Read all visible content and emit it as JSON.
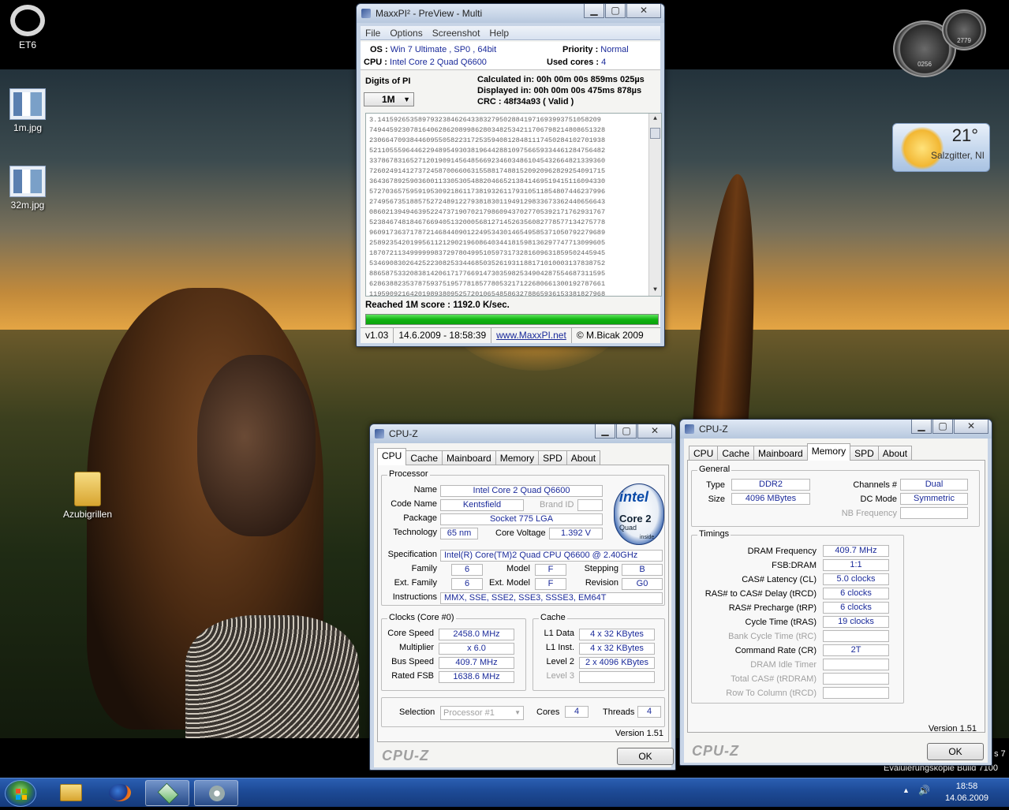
{
  "desktop": {
    "icons": [
      {
        "label": "ET6"
      },
      {
        "label": "1m.jpg"
      },
      {
        "label": "32m.jpg"
      },
      {
        "label": "Azubigrillen"
      }
    ],
    "gadgets": {
      "meter_cpu_value": "0256",
      "meter_ram_value": "2779",
      "weather_temp": "21°",
      "weather_city": "Salzgitter, NI"
    },
    "watermark": {
      "line1": "s 7",
      "line2": "Evaluierungskopie Build 7100"
    }
  },
  "maxxpi": {
    "title": "MaxxPI² - PreView - Multi",
    "menu": [
      "File",
      "Options",
      "Screenshot",
      "Help"
    ],
    "os_label": "OS :",
    "os_value": "Win 7 Ultimate , SP0 , 64bit",
    "cpu_label": "CPU :",
    "cpu_value": "Intel Core 2 Quad Q6600",
    "priority_label": "Priority :",
    "priority_value": "Normal",
    "cores_label": "Used cores :",
    "cores_value": "4",
    "digits_label": "Digits of PI",
    "digits_selected": "1M",
    "calculated": "Calculated in: 00h 00m 00s 859ms 025µs",
    "displayed": "Displayed  in: 00h 00m 00s 475ms 878µs",
    "crc": "CRC : 48f34a93 ( Valid )",
    "pi_lines": [
      "3.1415926535897932384626433832795028841971693993751058209",
      "7494459230781640628620899862803482534211706798214808651328",
      "2306647093844609550582231725359408128481117450284102701938",
      "5211055596446229489549303819644288109756659334461284756482",
      "3378678316527120190914564856692346034861045432664821339360",
      "7260249141273724587006606315588174881520920962829254091715",
      "3643678925903600113305305488204665213841469519415116094330",
      "5727036575959195309218611738193261179310511854807446237996",
      "2749567351885752724891227938183011949129833673362440656643",
      "0860213949463952247371907021798609437027705392171762931767",
      "5238467481846766940513200056812714526356082778577134275778",
      "9609173637178721468440901224953430146549585371050792279689",
      "2589235420199561121290219608640344181598136297747713099605",
      "1870721134999999837297804995105973173281609631859502445945",
      "5346908302642522308253344685035261931188171010003137838752",
      "8865875332083814206171776691473035982534904287554687311595",
      "6286388235378759375195778185778053217122680661300192787661",
      "1195909216420198938095257201065485863278865936153381827968",
      "2303019520353018529689957736225994138912497217752834791315"
    ],
    "score": "Reached 1M score : 1192.0 K/sec.",
    "status": [
      "v1.03",
      "14.6.2009 - 18:58:39",
      "www.MaxxPI.net",
      "© M.Bicak 2009"
    ]
  },
  "cpuz1": {
    "title": "CPU-Z",
    "tabs": [
      "CPU",
      "Cache",
      "Mainboard",
      "Memory",
      "SPD",
      "About"
    ],
    "active_tab": "CPU",
    "processor_group": "Processor",
    "name_label": "Name",
    "name": "Intel Core 2 Quad Q6600",
    "codename_label": "Code Name",
    "codename": "Kentsfield",
    "brandid_label": "Brand ID",
    "package_label": "Package",
    "package": "Socket 775 LGA",
    "technology_label": "Technology",
    "technology": "65 nm",
    "voltage_label": "Core Voltage",
    "voltage": "1.392 V",
    "spec_label": "Specification",
    "spec": "Intel(R) Core(TM)2 Quad CPU     Q6600  @ 2.40GHz",
    "family_label": "Family",
    "family": "6",
    "model_label": "Model",
    "model": "F",
    "stepping_label": "Stepping",
    "stepping": "B",
    "extfamily_label": "Ext. Family",
    "extfamily": "6",
    "extmodel_label": "Ext. Model",
    "extmodel": "F",
    "revision_label": "Revision",
    "revision": "G0",
    "instructions_label": "Instructions",
    "instructions": "MMX, SSE, SSE2, SSE3, SSSE3, EM64T",
    "intel_logo": {
      "brand": "intel",
      "product": "Core 2",
      "sub": "Quad",
      "inside": "inside"
    },
    "clocks_group": "Clocks (Core #0)",
    "corespeed_label": "Core Speed",
    "corespeed": "2458.0 MHz",
    "multiplier_label": "Multiplier",
    "multiplier": "x 6.0",
    "busspeed_label": "Bus Speed",
    "busspeed": "409.7 MHz",
    "ratedfsb_label": "Rated FSB",
    "ratedfsb": "1638.6 MHz",
    "cache_group": "Cache",
    "l1data_label": "L1 Data",
    "l1data": "4 x 32 KBytes",
    "l1inst_label": "L1 Inst.",
    "l1inst": "4 x 32 KBytes",
    "level2_label": "Level 2",
    "level2": "2 x 4096 KBytes",
    "level3_label": "Level 3",
    "selection_label": "Selection",
    "selection": "Processor #1",
    "cores_label": "Cores",
    "cores": "4",
    "threads_label": "Threads",
    "threads": "4",
    "version": "Version 1.51",
    "logo": "CPU-Z",
    "ok": "OK"
  },
  "cpuz2": {
    "title": "CPU-Z",
    "tabs": [
      "CPU",
      "Cache",
      "Mainboard",
      "Memory",
      "SPD",
      "About"
    ],
    "active_tab": "Memory",
    "general_group": "General",
    "type_label": "Type",
    "type": "DDR2",
    "size_label": "Size",
    "size": "4096 MBytes",
    "channels_label": "Channels #",
    "channels": "Dual",
    "dcmode_label": "DC Mode",
    "dcmode": "Symmetric",
    "nbfreq_label": "NB Frequency",
    "timings_group": "Timings",
    "dram_label": "DRAM Frequency",
    "dram": "409.7 MHz",
    "fsbdram_label": "FSB:DRAM",
    "fsbdram": "1:1",
    "cl_label": "CAS# Latency (CL)",
    "cl": "5.0 clocks",
    "trcd_label": "RAS# to CAS# Delay (tRCD)",
    "trcd": "6 clocks",
    "trp_label": "RAS# Precharge (tRP)",
    "trp": "6 clocks",
    "tras_label": "Cycle Time (tRAS)",
    "tras": "19 clocks",
    "trc_label": "Bank Cycle Time (tRC)",
    "cr_label": "Command Rate (CR)",
    "cr": "2T",
    "idle_label": "DRAM Idle Timer",
    "trdram_label": "Total CAS# (tRDRAM)",
    "trcd2_label": "Row To Column (tRCD)",
    "version": "Version 1.51",
    "logo": "CPU-Z",
    "ok": "OK"
  },
  "taskbar": {
    "time": "18:58",
    "date": "14.06.2009",
    "tray_up": "▲",
    "volume": "🔊"
  },
  "colors": {
    "accent": "#1a2a9a",
    "progress": "#12b312",
    "taskbar": "#1d4a96"
  }
}
